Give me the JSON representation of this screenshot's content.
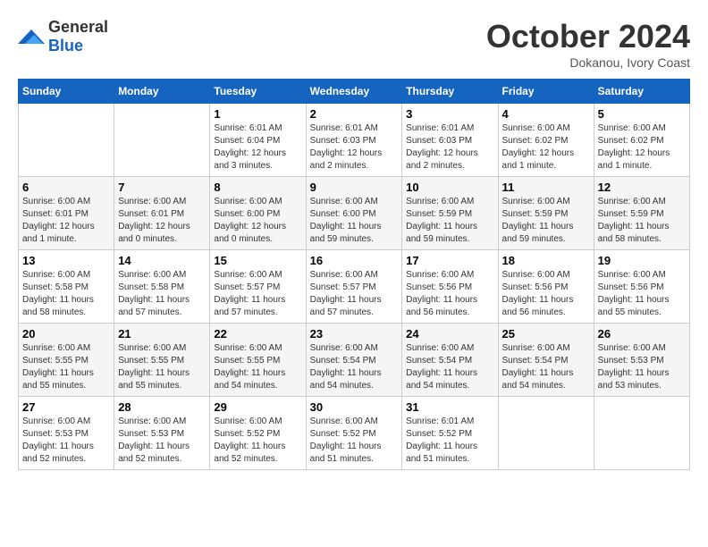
{
  "header": {
    "logo_general": "General",
    "logo_blue": "Blue",
    "month": "October 2024",
    "location": "Dokanou, Ivory Coast"
  },
  "days_of_week": [
    "Sunday",
    "Monday",
    "Tuesday",
    "Wednesday",
    "Thursday",
    "Friday",
    "Saturday"
  ],
  "weeks": [
    [
      {
        "day": "",
        "info": ""
      },
      {
        "day": "",
        "info": ""
      },
      {
        "day": "1",
        "info": "Sunrise: 6:01 AM\nSunset: 6:04 PM\nDaylight: 12 hours and 3 minutes."
      },
      {
        "day": "2",
        "info": "Sunrise: 6:01 AM\nSunset: 6:03 PM\nDaylight: 12 hours and 2 minutes."
      },
      {
        "day": "3",
        "info": "Sunrise: 6:01 AM\nSunset: 6:03 PM\nDaylight: 12 hours and 2 minutes."
      },
      {
        "day": "4",
        "info": "Sunrise: 6:00 AM\nSunset: 6:02 PM\nDaylight: 12 hours and 1 minute."
      },
      {
        "day": "5",
        "info": "Sunrise: 6:00 AM\nSunset: 6:02 PM\nDaylight: 12 hours and 1 minute."
      }
    ],
    [
      {
        "day": "6",
        "info": "Sunrise: 6:00 AM\nSunset: 6:01 PM\nDaylight: 12 hours and 1 minute."
      },
      {
        "day": "7",
        "info": "Sunrise: 6:00 AM\nSunset: 6:01 PM\nDaylight: 12 hours and 0 minutes."
      },
      {
        "day": "8",
        "info": "Sunrise: 6:00 AM\nSunset: 6:00 PM\nDaylight: 12 hours and 0 minutes."
      },
      {
        "day": "9",
        "info": "Sunrise: 6:00 AM\nSunset: 6:00 PM\nDaylight: 11 hours and 59 minutes."
      },
      {
        "day": "10",
        "info": "Sunrise: 6:00 AM\nSunset: 5:59 PM\nDaylight: 11 hours and 59 minutes."
      },
      {
        "day": "11",
        "info": "Sunrise: 6:00 AM\nSunset: 5:59 PM\nDaylight: 11 hours and 59 minutes."
      },
      {
        "day": "12",
        "info": "Sunrise: 6:00 AM\nSunset: 5:59 PM\nDaylight: 11 hours and 58 minutes."
      }
    ],
    [
      {
        "day": "13",
        "info": "Sunrise: 6:00 AM\nSunset: 5:58 PM\nDaylight: 11 hours and 58 minutes."
      },
      {
        "day": "14",
        "info": "Sunrise: 6:00 AM\nSunset: 5:58 PM\nDaylight: 11 hours and 57 minutes."
      },
      {
        "day": "15",
        "info": "Sunrise: 6:00 AM\nSunset: 5:57 PM\nDaylight: 11 hours and 57 minutes."
      },
      {
        "day": "16",
        "info": "Sunrise: 6:00 AM\nSunset: 5:57 PM\nDaylight: 11 hours and 57 minutes."
      },
      {
        "day": "17",
        "info": "Sunrise: 6:00 AM\nSunset: 5:56 PM\nDaylight: 11 hours and 56 minutes."
      },
      {
        "day": "18",
        "info": "Sunrise: 6:00 AM\nSunset: 5:56 PM\nDaylight: 11 hours and 56 minutes."
      },
      {
        "day": "19",
        "info": "Sunrise: 6:00 AM\nSunset: 5:56 PM\nDaylight: 11 hours and 55 minutes."
      }
    ],
    [
      {
        "day": "20",
        "info": "Sunrise: 6:00 AM\nSunset: 5:55 PM\nDaylight: 11 hours and 55 minutes."
      },
      {
        "day": "21",
        "info": "Sunrise: 6:00 AM\nSunset: 5:55 PM\nDaylight: 11 hours and 55 minutes."
      },
      {
        "day": "22",
        "info": "Sunrise: 6:00 AM\nSunset: 5:55 PM\nDaylight: 11 hours and 54 minutes."
      },
      {
        "day": "23",
        "info": "Sunrise: 6:00 AM\nSunset: 5:54 PM\nDaylight: 11 hours and 54 minutes."
      },
      {
        "day": "24",
        "info": "Sunrise: 6:00 AM\nSunset: 5:54 PM\nDaylight: 11 hours and 54 minutes."
      },
      {
        "day": "25",
        "info": "Sunrise: 6:00 AM\nSunset: 5:54 PM\nDaylight: 11 hours and 54 minutes."
      },
      {
        "day": "26",
        "info": "Sunrise: 6:00 AM\nSunset: 5:53 PM\nDaylight: 11 hours and 53 minutes."
      }
    ],
    [
      {
        "day": "27",
        "info": "Sunrise: 6:00 AM\nSunset: 5:53 PM\nDaylight: 11 hours and 52 minutes."
      },
      {
        "day": "28",
        "info": "Sunrise: 6:00 AM\nSunset: 5:53 PM\nDaylight: 11 hours and 52 minutes."
      },
      {
        "day": "29",
        "info": "Sunrise: 6:00 AM\nSunset: 5:52 PM\nDaylight: 11 hours and 52 minutes."
      },
      {
        "day": "30",
        "info": "Sunrise: 6:00 AM\nSunset: 5:52 PM\nDaylight: 11 hours and 51 minutes."
      },
      {
        "day": "31",
        "info": "Sunrise: 6:01 AM\nSunset: 5:52 PM\nDaylight: 11 hours and 51 minutes."
      },
      {
        "day": "",
        "info": ""
      },
      {
        "day": "",
        "info": ""
      }
    ]
  ]
}
